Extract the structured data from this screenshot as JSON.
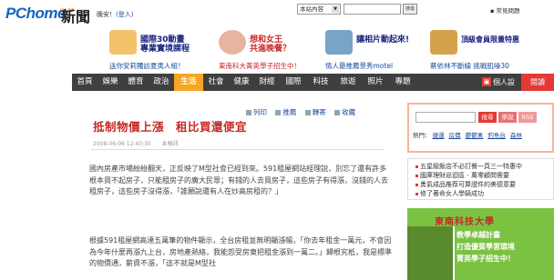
{
  "header": {
    "logo": "PChome",
    "logo_sub": "ONLINE",
    "brand": "新聞",
    "greeting": "晚安！",
    "login": "(登入)",
    "search_select": "本站內容",
    "search_button": "搜尋",
    "help": "常見問題"
  },
  "promos": [
    {
      "text": "國際30動畫\n專業實境課程",
      "link": "送你安莉獨訪夏夷人組！"
    },
    {
      "text": "想和女王\n共進晚餐？",
      "link": "東南科大菁英學子招生中！"
    },
    {
      "text": "讓相片動起來!",
      "link": "情人最推薦景秀motel"
    },
    {
      "text": "頂級會員限量特惠",
      "link": "蔡依林不斷線 挑戰肌噪30"
    }
  ],
  "nav": {
    "items": [
      "首頁",
      "娛樂",
      "體育",
      "政治",
      "生活",
      "社會",
      "健康",
      "財經",
      "國際",
      "科技",
      "旅遊",
      "照片",
      "專題"
    ],
    "active_index": 4,
    "settings": "個人設定",
    "read": "閱讀"
  },
  "article": {
    "tools": [
      "列印",
      "推薦",
      "轉寄",
      "收藏"
    ],
    "title": "抵制物價上漲　租比買還便宜",
    "meta": "2008-06-06 12:40:30　　本報訊",
    "paragraph1": "國內房產市場紛紛翻天，正反映了M型社會已經到來。591租屋網站經理說，別忘了還有許多根本買不起房子，只能租房子的廣大民眾；有錢的人去買房子，這些房子有得漲，沒錢的人去租房子，這些房子沒得漲，「誰願說還有人在炒高房租的？」",
    "paragraph2": "根據591租屋網高達五萬筆的物件顯示，全台房租並無明顯漲幅，「你去年租金一萬元，不會因為今年什麼再漲九上台，房地產熱絡，我能怨受房東把租金漲到一萬二。」歸根究柢，我是標準的物價通，薪資不漲，「這不就是M型社"
  },
  "sidebar": {
    "search_buttons": [
      "搜尋",
      "學說",
      "RSS"
    ],
    "hot_label": "熱門：",
    "hot_links": [
      "捷運",
      "房價",
      "鬱鬱禽",
      "釣魚台",
      "森林"
    ],
    "links": [
      "五星級飯店不必訂餐一頁三一特惠中",
      "國庫理財巡迴區 - 萬零顧問需要",
      "勇氣成品推荐可算證件的美德意要",
      "修了著命女人學騎成功"
    ],
    "ad": {
      "title": "東南科技大學",
      "line1": "教學卓越計畫",
      "line2": "打造優質學習環境",
      "line3": "菁英學子招生中！"
    }
  },
  "colors": {
    "nav_bg": "#3f3f3f",
    "nav_active": "#f5a623",
    "title_red": "#c62828",
    "link_blue": "#1a4a9b"
  }
}
